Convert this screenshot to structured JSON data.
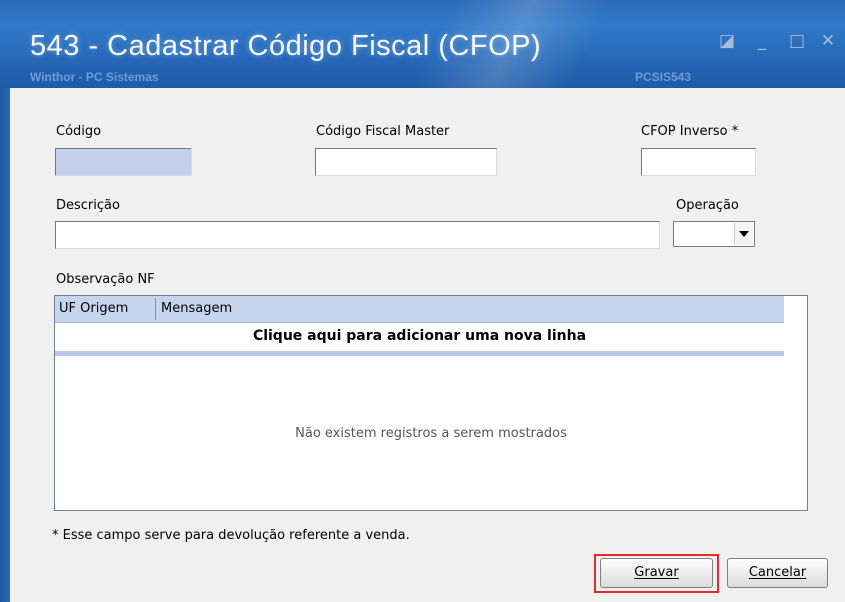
{
  "window": {
    "title": "543 - Cadastrar Código Fiscal (CFOP)",
    "app_name": "Winthor - PC Sistemas",
    "routine_code": "PCSIS543",
    "controls": {
      "restore": "◪",
      "minimize": "_",
      "maximize": "□",
      "close": "✕"
    }
  },
  "form": {
    "codigo": {
      "label": "Código",
      "value": ""
    },
    "codigo_fiscal_master": {
      "label": "Código Fiscal Master",
      "value": ""
    },
    "cfop_inverso": {
      "label": "CFOP Inverso *",
      "value": ""
    },
    "descricao": {
      "label": "Descrição",
      "value": ""
    },
    "operacao": {
      "label": "Operação",
      "value": ""
    }
  },
  "observacao": {
    "label": "Observação NF",
    "columns": [
      "UF Origem",
      "Mensagem"
    ],
    "add_row_text": "Clique aqui para adicionar uma nova linha",
    "empty_text": "Não existem registros a serem mostrados"
  },
  "footnote": "* Esse campo serve para devolução referente a venda.",
  "buttons": {
    "gravar": "Gravar",
    "cancelar": "Cancelar"
  },
  "colors": {
    "titlebar": "#2b6ab8",
    "highlight": "#e32b2b",
    "grid_header": "#c5d5ee",
    "readonly_field": "#c3d0ec"
  }
}
